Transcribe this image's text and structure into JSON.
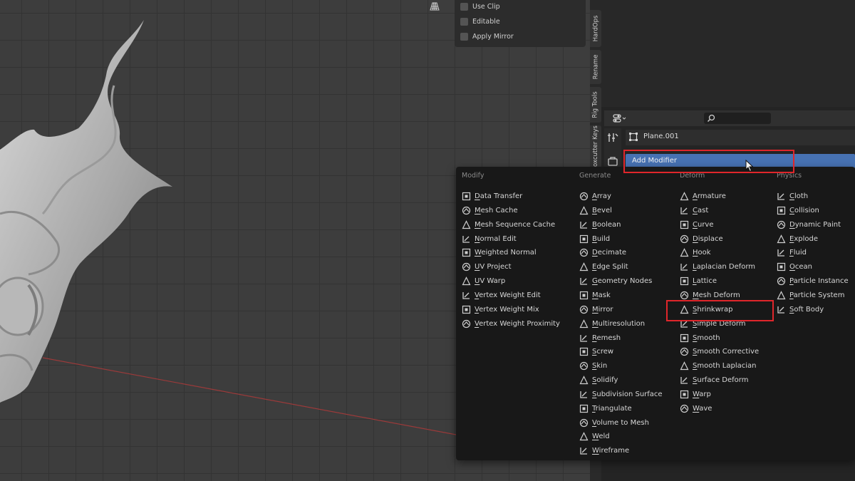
{
  "viewport": {
    "overlay_options": [
      {
        "label": "Use Clip"
      },
      {
        "label": "Editable"
      },
      {
        "label": "Apply Mirror"
      }
    ]
  },
  "side_tabs": [
    "HardOps",
    "Rename",
    "Rig Tools",
    "Boxcutter Keys"
  ],
  "properties": {
    "object_name": "Plane.001",
    "add_modifier_label": "Add Modifier"
  },
  "menu": {
    "columns": [
      {
        "title": "Modify",
        "items": [
          {
            "label": "Data Transfer",
            "icon": "data-transfer-icon"
          },
          {
            "label": "Mesh Cache",
            "icon": "mesh-cache-icon"
          },
          {
            "label": "Mesh Sequence Cache",
            "icon": "mesh-sequence-cache-icon"
          },
          {
            "label": "Normal Edit",
            "icon": "normal-edit-icon"
          },
          {
            "label": "Weighted Normal",
            "icon": "weighted-normal-icon"
          },
          {
            "label": "UV Project",
            "icon": "uv-project-icon"
          },
          {
            "label": "UV Warp",
            "icon": "uv-warp-icon"
          },
          {
            "label": "Vertex Weight Edit",
            "icon": "vertex-weight-edit-icon"
          },
          {
            "label": "Vertex Weight Mix",
            "icon": "vertex-weight-mix-icon"
          },
          {
            "label": "Vertex Weight Proximity",
            "icon": "vertex-weight-proximity-icon"
          }
        ]
      },
      {
        "title": "Generate",
        "items": [
          {
            "label": "Array",
            "icon": "array-icon"
          },
          {
            "label": "Bevel",
            "icon": "bevel-icon"
          },
          {
            "label": "Boolean",
            "icon": "boolean-icon"
          },
          {
            "label": "Build",
            "icon": "build-icon"
          },
          {
            "label": "Decimate",
            "icon": "decimate-icon"
          },
          {
            "label": "Edge Split",
            "icon": "edge-split-icon"
          },
          {
            "label": "Geometry Nodes",
            "icon": "geometry-nodes-icon"
          },
          {
            "label": "Mask",
            "icon": "mask-icon"
          },
          {
            "label": "Mirror",
            "icon": "mirror-icon"
          },
          {
            "label": "Multiresolution",
            "icon": "multiresolution-icon"
          },
          {
            "label": "Remesh",
            "icon": "remesh-icon"
          },
          {
            "label": "Screw",
            "icon": "screw-icon"
          },
          {
            "label": "Skin",
            "icon": "skin-icon"
          },
          {
            "label": "Solidify",
            "icon": "solidify-icon"
          },
          {
            "label": "Subdivision Surface",
            "icon": "subdivision-surface-icon"
          },
          {
            "label": "Triangulate",
            "icon": "triangulate-icon"
          },
          {
            "label": "Volume to Mesh",
            "icon": "volume-to-mesh-icon"
          },
          {
            "label": "Weld",
            "icon": "weld-icon"
          },
          {
            "label": "Wireframe",
            "icon": "wireframe-icon"
          }
        ]
      },
      {
        "title": "Deform",
        "items": [
          {
            "label": "Armature",
            "icon": "armature-icon"
          },
          {
            "label": "Cast",
            "icon": "cast-icon"
          },
          {
            "label": "Curve",
            "icon": "curve-icon"
          },
          {
            "label": "Displace",
            "icon": "displace-icon"
          },
          {
            "label": "Hook",
            "icon": "hook-icon"
          },
          {
            "label": "Laplacian Deform",
            "icon": "laplacian-deform-icon"
          },
          {
            "label": "Lattice",
            "icon": "lattice-icon"
          },
          {
            "label": "Mesh Deform",
            "icon": "mesh-deform-icon"
          },
          {
            "label": "Shrinkwrap",
            "icon": "shrinkwrap-icon"
          },
          {
            "label": "Simple Deform",
            "icon": "simple-deform-icon"
          },
          {
            "label": "Smooth",
            "icon": "smooth-icon"
          },
          {
            "label": "Smooth Corrective",
            "icon": "smooth-corrective-icon"
          },
          {
            "label": "Smooth Laplacian",
            "icon": "smooth-laplacian-icon"
          },
          {
            "label": "Surface Deform",
            "icon": "surface-deform-icon"
          },
          {
            "label": "Warp",
            "icon": "warp-icon"
          },
          {
            "label": "Wave",
            "icon": "wave-icon"
          }
        ]
      },
      {
        "title": "Physics",
        "items": [
          {
            "label": "Cloth",
            "icon": "cloth-icon"
          },
          {
            "label": "Collision",
            "icon": "collision-icon"
          },
          {
            "label": "Dynamic Paint",
            "icon": "dynamic-paint-icon"
          },
          {
            "label": "Explode",
            "icon": "explode-icon"
          },
          {
            "label": "Fluid",
            "icon": "fluid-icon"
          },
          {
            "label": "Ocean",
            "icon": "ocean-icon"
          },
          {
            "label": "Particle Instance",
            "icon": "particle-instance-icon"
          },
          {
            "label": "Particle System",
            "icon": "particle-system-icon"
          },
          {
            "label": "Soft Body",
            "icon": "soft-body-icon"
          }
        ]
      }
    ]
  },
  "colors": {
    "accent": "#4772b3",
    "highlight": "#e0262b",
    "menu_bg": "#181818"
  }
}
